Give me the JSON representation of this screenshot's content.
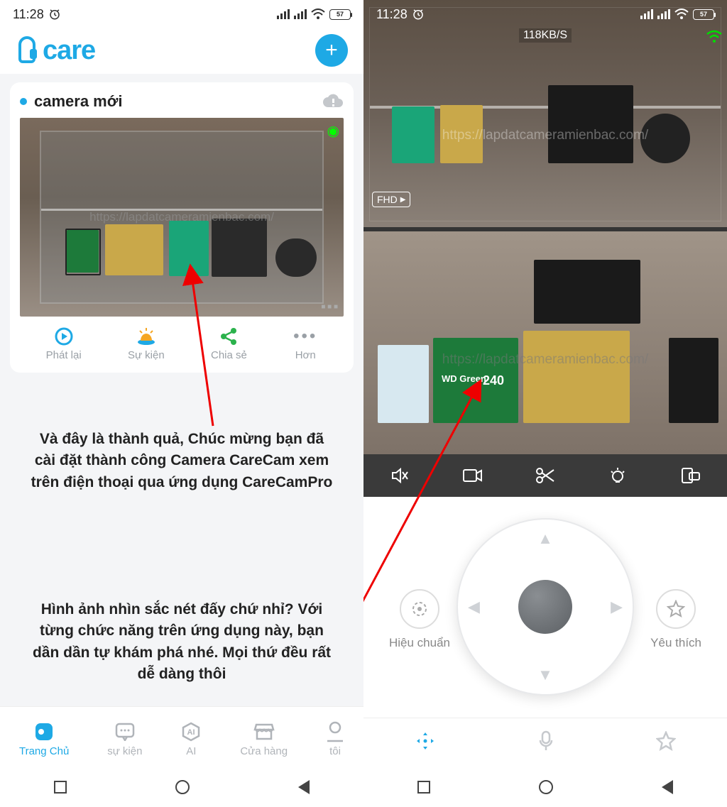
{
  "status": {
    "time": "11:28",
    "battery": "57"
  },
  "left": {
    "logo": "care",
    "camera_name": "camera mới",
    "watermark": "https://lapdatcameramienbac.com/",
    "actions": {
      "replay": "Phát lại",
      "event": "Sự kiện",
      "share": "Chia sẻ",
      "more": "Hơn"
    },
    "annotation1": "Và đây là thành quả, Chúc mừng bạn đã cài đặt thành công Camera CareCam xem trên điện thoại qua ứng dụng CareCamPro",
    "annotation2": "Hình ảnh nhìn sắc nét đấy chứ nhỉ? Với từng chức năng trên ứng dụng này, bạn dần dần tự khám phá nhé. Mọi thứ đều rất dễ dàng thôi",
    "nav": {
      "home": "Trang Chủ",
      "event": "sự kiện",
      "ai": "AI",
      "store": "Cửa hàng",
      "me": "tôi"
    }
  },
  "right": {
    "bitrate": "118KB/S",
    "resolution": "FHD",
    "watermark": "https://lapdatcameramienbac.com/",
    "product_label_1": "WD Green",
    "product_label_2": "240",
    "side": {
      "calibrate": "Hiệu chuẩn",
      "favorite": "Yêu thích"
    }
  }
}
